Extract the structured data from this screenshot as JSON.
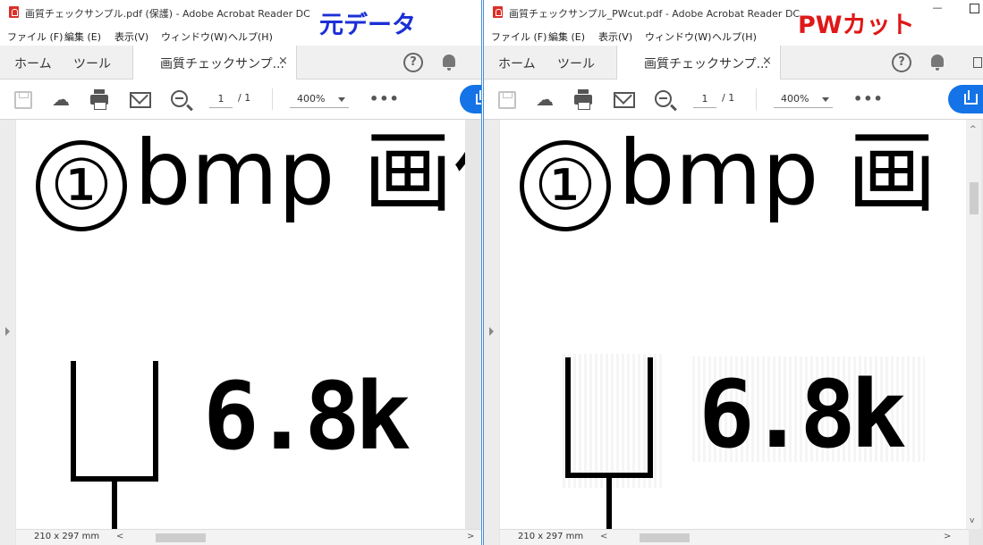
{
  "colors": {
    "left_label": "#1b2fd6",
    "right_label": "#e01818",
    "accent": "#1473e6",
    "pdf_icon": "#d9302a"
  },
  "left": {
    "window_title": "画質チェックサンプル.pdf (保護) - Adobe Acrobat Reader DC",
    "overlay_label": "元データ",
    "menu": [
      "ファイル (F)",
      "編集 (E)",
      "表示(V)",
      "ウィンドウ(W)",
      "ヘルプ(H)"
    ],
    "nav": {
      "home": "ホーム",
      "tools": "ツール"
    },
    "doc_tab": "画質チェックサンプ...",
    "tab_close": "×",
    "page_current": "1",
    "page_total": "/ 1",
    "zoom": "400%",
    "more": "•••",
    "page_heading_circle": "①",
    "page_heading": "bmp 画像",
    "big_value": "6.8k",
    "page_size": "210 x 297 mm",
    "scroll_left": "<",
    "scroll_right": ">"
  },
  "right": {
    "window_title": "画質チェックサンプル_PWcut.pdf - Adobe Acrobat Reader DC",
    "overlay_label": "PWカット",
    "menu": [
      "ファイル (F)",
      "編集 (E)",
      "表示(V)",
      "ウィンドウ(W)",
      "ヘルプ(H)"
    ],
    "nav": {
      "home": "ホーム",
      "tools": "ツール"
    },
    "doc_tab": "画質チェックサンプ...",
    "tab_close": "×",
    "page_current": "1",
    "page_total": "/ 1",
    "zoom": "400%",
    "more": "•••",
    "page_heading_circle": "①",
    "page_heading": "bmp 画",
    "big_value": "6.8k",
    "page_size": "210 x 297 mm",
    "scroll_left": "<",
    "scroll_right": ">",
    "scroll_up": "^",
    "scroll_down": "v"
  },
  "icons": {
    "pdf": "pdf-file-icon",
    "help": "help-icon",
    "notifications": "bell-icon",
    "save": "save-icon",
    "upload": "cloud-upload-icon",
    "print": "print-icon",
    "mail": "mail-icon",
    "zoom": "zoom-out-icon",
    "share": "share-icon"
  }
}
